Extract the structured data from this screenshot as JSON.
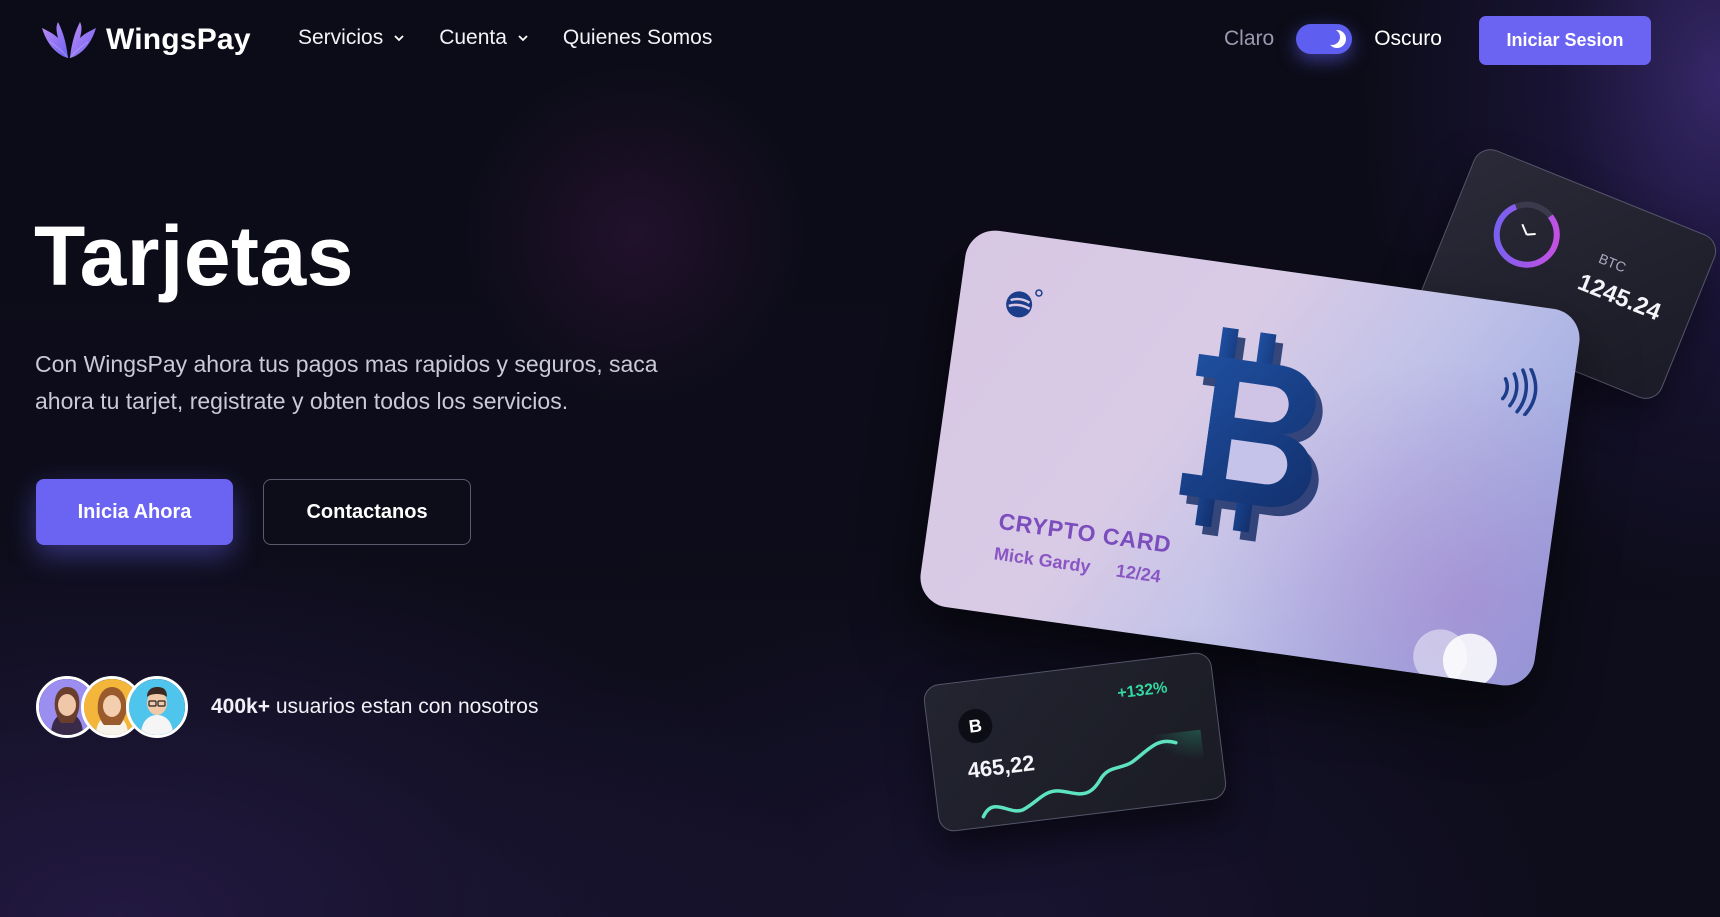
{
  "brand": {
    "name": "WingsPay",
    "logo_icon": "wings-logo-icon"
  },
  "nav": {
    "items": [
      {
        "label": "Servicios",
        "has_dropdown": true
      },
      {
        "label": "Cuenta",
        "has_dropdown": true
      },
      {
        "label": "Quienes Somos",
        "has_dropdown": false
      }
    ]
  },
  "theme_toggle": {
    "light_label": "Claro",
    "dark_label": "Oscuro",
    "state": "dark"
  },
  "login_button": "Iniciar Sesion",
  "hero": {
    "title": "Tarjetas",
    "description": "Con WingsPay ahora tus pagos mas rapidos y seguros, saca ahora tu tarjet, registrate y obten todos los servicios.",
    "primary_cta": "Inicia Ahora",
    "secondary_cta": "Contactanos"
  },
  "social_proof": {
    "count": "400k+",
    "text": "usuarios estan con nosotros"
  },
  "crypto_card": {
    "title": "CRYPTO CARD",
    "holder": "Mick Gardy",
    "expiry": "12/24"
  },
  "btc_widget": {
    "label": "BTC",
    "value": "1245.24"
  },
  "chart_widget": {
    "icon_letter": "B",
    "change": "+132%",
    "value": "465,22"
  },
  "colors": {
    "accent": "#6b63f2",
    "positive": "#34d6a0",
    "background": "#0c0c18"
  }
}
